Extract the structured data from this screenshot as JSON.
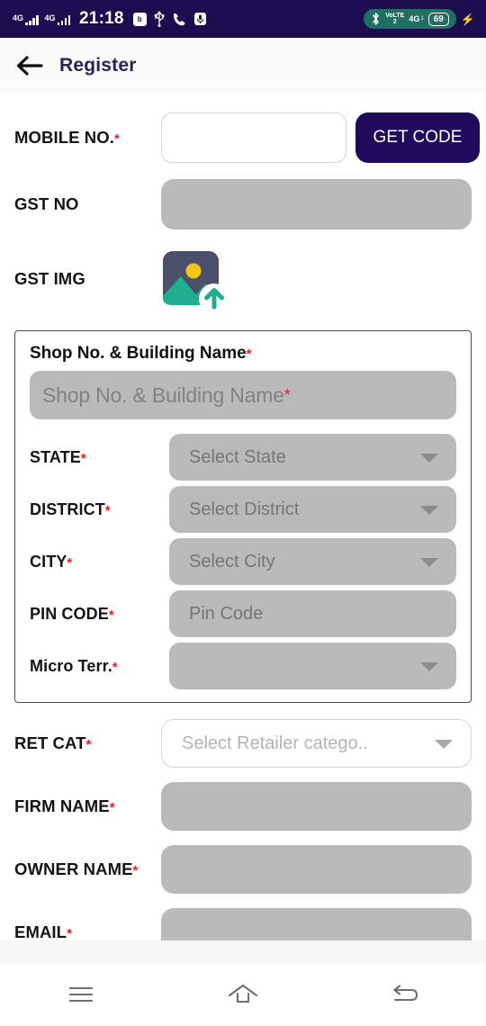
{
  "status_bar": {
    "network_1": "4G",
    "network_2": "4G",
    "time": "21:18",
    "badge_label": "b",
    "volte_line1": "VoLTE",
    "volte_line2": "2",
    "net_label": "4G",
    "net_sub": "1",
    "battery_percent": "69",
    "charging_glyph": "⚡",
    "background_color": "#1d0c50",
    "pill_color": "#1f6f63"
  },
  "app_bar": {
    "title": "Register",
    "back_icon": "arrow-left-icon",
    "title_color": "#28215e"
  },
  "form": {
    "mobile": {
      "label": "MOBILE NO.",
      "required": "*",
      "value": "",
      "placeholder": "",
      "button_label": "GET CODE",
      "button_color": "#1f0a5c"
    },
    "gst_no": {
      "label": "GST NO",
      "required": "",
      "value": "",
      "placeholder": ""
    },
    "gst_img": {
      "label": "GST IMG",
      "required": "",
      "icon": "image-upload-icon",
      "icon_frame_color": "#4a4f6a",
      "icon_sun_color": "#f5c518",
      "icon_mountain_color": "#1fae8f"
    },
    "address_card": {
      "title": "Shop No. & Building Name",
      "title_required": "*",
      "shop_input": {
        "placeholder": "Shop No. & Building Name",
        "required": "*",
        "value": ""
      },
      "rows": [
        {
          "label": "STATE",
          "required": "*",
          "value": "Select State",
          "type": "dropdown"
        },
        {
          "label": "DISTRICT",
          "required": "*",
          "value": "Select District",
          "type": "dropdown"
        },
        {
          "label": "CITY",
          "required": "*",
          "value": "Select City",
          "type": "dropdown"
        },
        {
          "label": "PIN CODE",
          "required": "*",
          "value": "Pin Code",
          "type": "text"
        },
        {
          "label": "Micro Terr.",
          "required": "*",
          "value": "",
          "type": "dropdown"
        }
      ]
    },
    "ret_cat": {
      "label": "RET CAT",
      "required": "*",
      "value": "Select Retailer catego.."
    },
    "firm_name": {
      "label": "FIRM NAME",
      "required": "*",
      "value": ""
    },
    "owner_name": {
      "label": "OWNER NAME",
      "required": "*",
      "value": ""
    },
    "email": {
      "label": "EMAIL",
      "required": "*",
      "value": ""
    }
  },
  "nav_bar": {
    "recents": "menu-icon",
    "home": "home-icon",
    "back": "back-icon"
  },
  "colors": {
    "disabled_field": "#bababa",
    "required_star": "#e02020",
    "page_background": "#ffffff"
  }
}
